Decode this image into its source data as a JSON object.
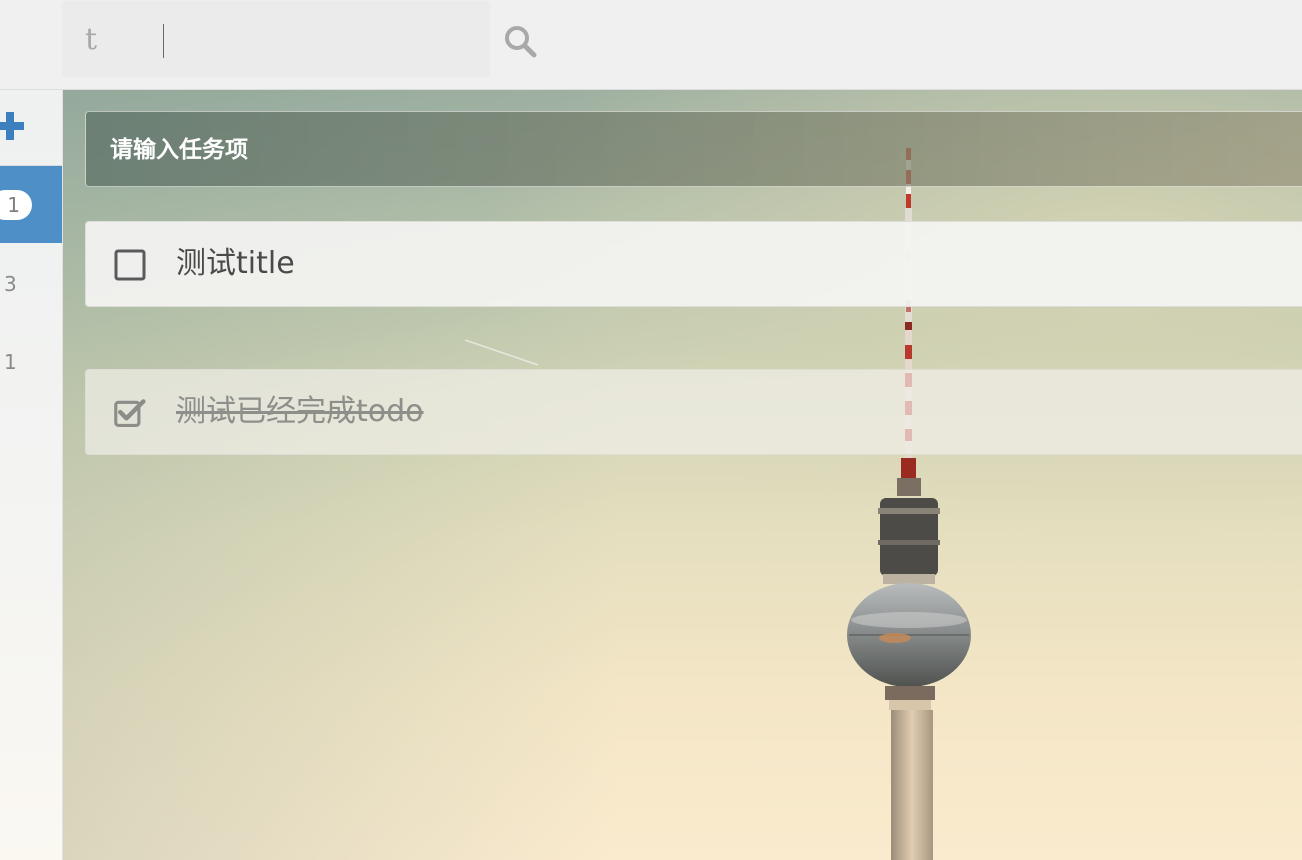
{
  "search": {
    "value": "t"
  },
  "sidebar": {
    "items": [
      {
        "count": "1",
        "active": true
      },
      {
        "count": "3",
        "active": false
      },
      {
        "count": "1",
        "active": false
      }
    ]
  },
  "task_input": {
    "placeholder": "请输入任务项"
  },
  "todos": [
    {
      "title": "测试title",
      "done": false
    },
    {
      "title": "测试已经完成todo",
      "done": true
    }
  ],
  "icons": {
    "search": "search-icon",
    "add": "plus-icon",
    "unchecked": "checkbox-unchecked-icon",
    "checked": "checkbox-checked-icon"
  },
  "colors": {
    "accent": "#4f8fc8",
    "plus": "#3b7fbf",
    "topbar": "#f0f0f0"
  }
}
